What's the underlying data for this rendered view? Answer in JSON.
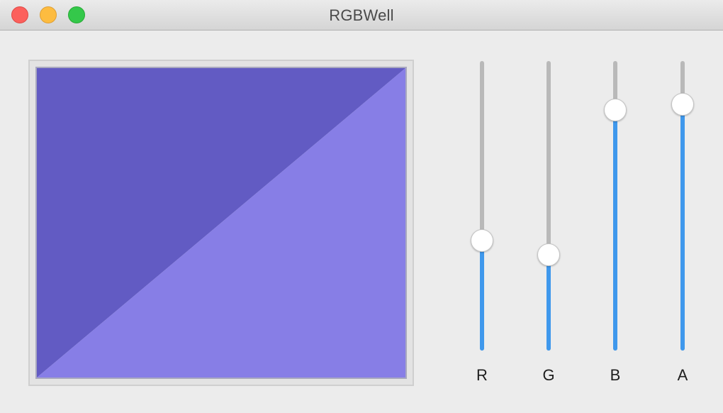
{
  "window": {
    "title": "RGBWell"
  },
  "colors": {
    "upper_triangle": "#625bc3",
    "lower_triangle": "#877ee6",
    "slider_fill": "#3f98ec",
    "slider_track": "#b9b9b9"
  },
  "sliders": [
    {
      "label": "R",
      "value": 0.38
    },
    {
      "label": "G",
      "value": 0.33
    },
    {
      "label": "B",
      "value": 0.83
    },
    {
      "label": "A",
      "value": 0.85
    }
  ]
}
